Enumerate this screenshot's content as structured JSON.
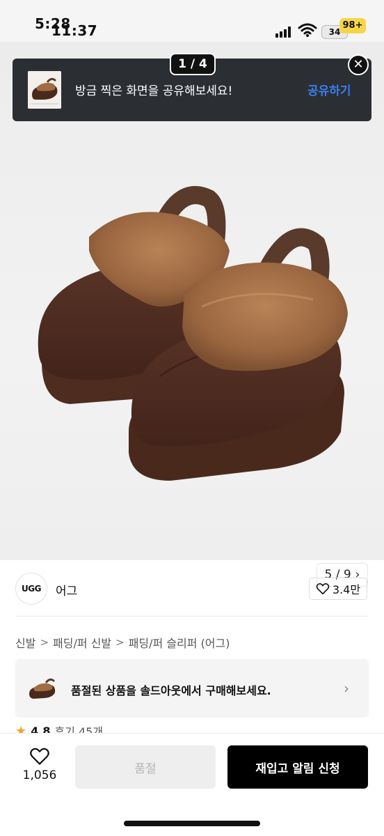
{
  "status_bar": {
    "time_primary": "5:28",
    "time_overlay": "11:37",
    "battery_back": "34",
    "battery_front": "98+"
  },
  "share_banner": {
    "page_indicator": "1 / 4",
    "text": "방금 찍은 화면을 공유해보세요!",
    "action_label": "공유하기",
    "close_icon": "✕"
  },
  "gallery": {
    "counter": "5 / 9",
    "next_icon": "›"
  },
  "brand": {
    "logo_text": "UGG",
    "name": "어그",
    "like_count": "3.4만"
  },
  "breadcrumb": {
    "items": [
      "신발",
      "패딩/퍼 신발",
      "패딩/퍼 슬리퍼 (어그)"
    ],
    "separator": ">"
  },
  "soldout_notice": {
    "text": "품절된 상품을 솔드아웃에서 구매해보세요.",
    "chevron": "›"
  },
  "rating": {
    "star": "★",
    "score": "4.8",
    "reviews": "후기 45개"
  },
  "bottom_bar": {
    "wish_count": "1,056",
    "soldout_label": "품절",
    "restock_label": "재입고 알림 신청"
  },
  "colors": {
    "banner_bg": "#2b2f33",
    "share_action": "#3b7cf0",
    "primary_button": "#000000",
    "star": "#f2a324"
  }
}
